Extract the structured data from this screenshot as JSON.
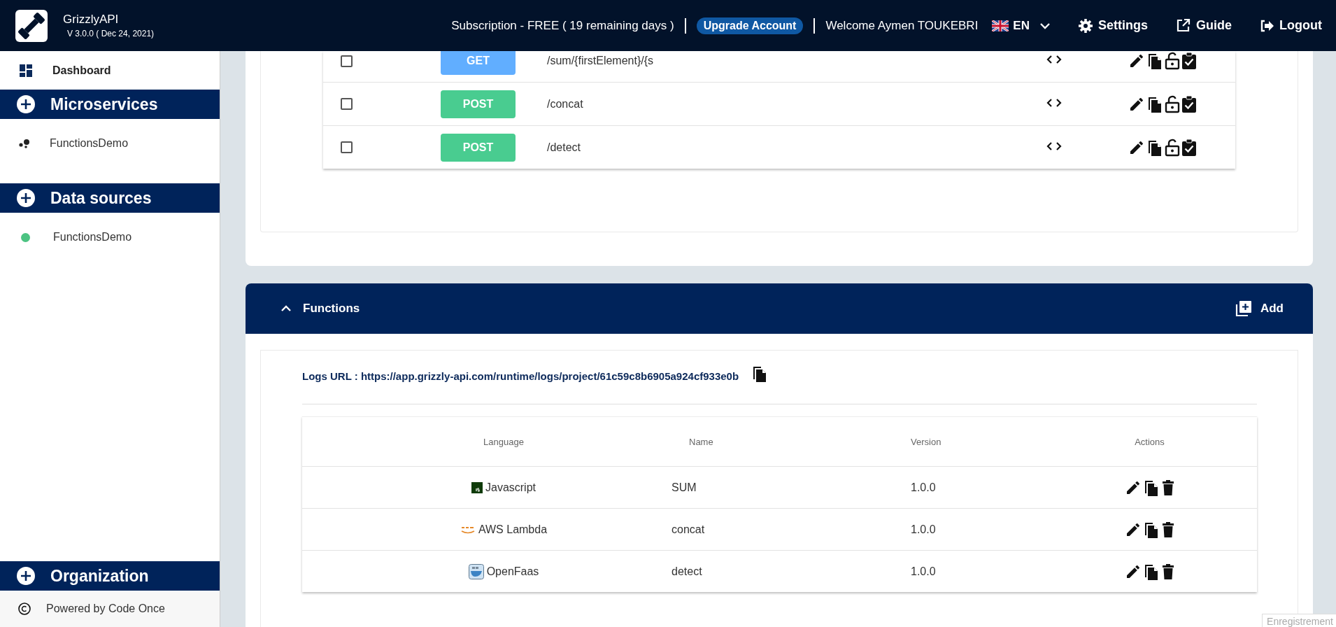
{
  "header": {
    "app_name": "GrizzlyAPI",
    "version": "V 3.0.0 ( Dec 24, 2021)",
    "subscription": "Subscription  - FREE ( 19 remaining days )",
    "upgrade_button": "Upgrade Account",
    "welcome": "Welcome  Aymen   TOUKEBRI",
    "language": "EN",
    "nav": [
      {
        "kind": "settings",
        "label": "Settings"
      },
      {
        "kind": "guide",
        "label": "Guide"
      },
      {
        "kind": "logout",
        "label": "Logout"
      }
    ]
  },
  "sidebar": {
    "dashboard": "Dashboard",
    "sections": [
      {
        "title": "Microservices",
        "items": [
          {
            "kind": "microservice",
            "label": "FunctionsDemo"
          }
        ]
      },
      {
        "title": "Data sources",
        "items": [
          {
            "kind": "datasource",
            "label": "FunctionsDemo",
            "color": "#4cc382"
          }
        ]
      },
      {
        "title": "Organization"
      }
    ],
    "footer": "Powered by Code Once"
  },
  "endpoints": {
    "rows": [
      {
        "checked": false,
        "method": "GET",
        "kind": "get",
        "path": "/sum/{firstElement}/{s"
      },
      {
        "checked": false,
        "method": "POST",
        "kind": "post",
        "path": "/concat"
      },
      {
        "checked": false,
        "method": "POST",
        "kind": "post",
        "path": "/detect"
      }
    ]
  },
  "functions": {
    "title": "Functions",
    "expanded": true,
    "add_button": "Add",
    "logs_url": "Logs URL : https://app.grizzly-api.com/runtime/logs/project/61c59c8b6905a924cf933e0b",
    "columns": [
      "Language",
      "Name",
      "Version",
      "Actions"
    ],
    "rows": [
      {
        "kind": "javascript",
        "language": "Javascript",
        "name": "SUM",
        "version": "1.0.0"
      },
      {
        "kind": "aws",
        "language": "AWS Lambda",
        "name": "concat",
        "version": "1.0.0"
      },
      {
        "kind": "openfaas",
        "language": "OpenFaas",
        "name": "detect",
        "version": "1.0.0"
      }
    ]
  },
  "overlay_label": "Enregistrement"
}
